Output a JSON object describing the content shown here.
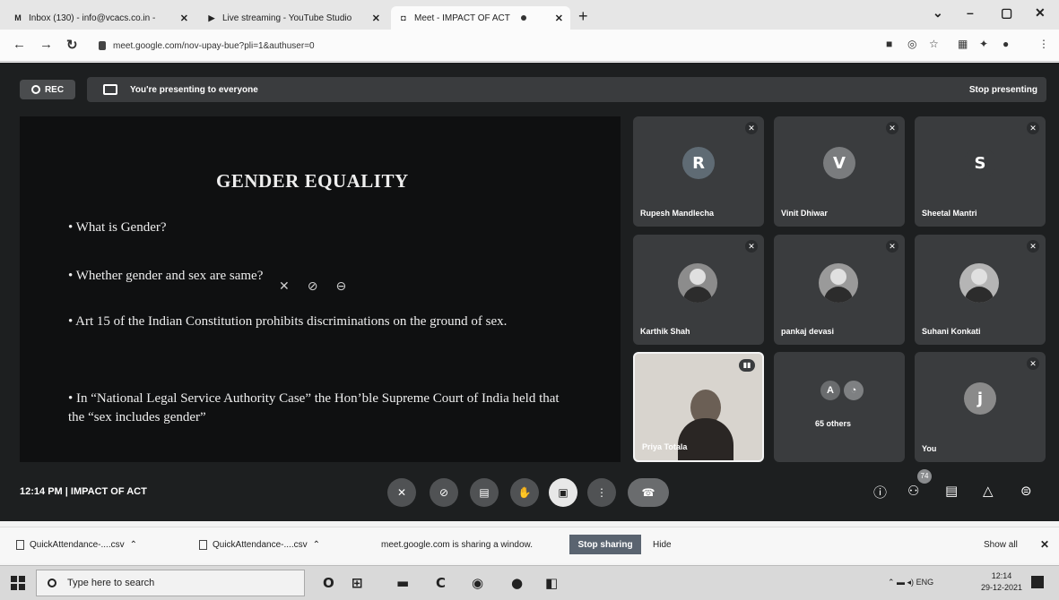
{
  "browser": {
    "tabs": [
      {
        "label": "Inbox (130) - info@vcacs.co.in -",
        "icon": "M"
      },
      {
        "label": "Live streaming - YouTube Studio",
        "icon": "▶"
      },
      {
        "label": "Meet - IMPACT OF ACT",
        "icon": "◘"
      }
    ],
    "url": "meet.google.com/nov-upay-bue?pli=1&authuser=0",
    "window_controls": {
      "minimize": "–",
      "maximize": "▢",
      "close": "✕"
    }
  },
  "meet": {
    "rec_label": "REC",
    "presenting_text": "You're presenting to everyone",
    "stop_presenting_label": "Stop presenting",
    "slide": {
      "title": "GENDER EQUALITY",
      "bullets": [
        "• What is Gender?",
        "• Whether gender and sex are same?",
        "• Art 15 of the Indian Constitution prohibits discriminations on the ground of sex.",
        "• In “National Legal Service Authority Case” the Hon’ble Supreme Court of India held that the “sex includes gender”"
      ]
    },
    "participants": [
      {
        "name": "Rupesh Mandlecha",
        "initial": "R",
        "color": "#5f6b74"
      },
      {
        "name": "Vinit Dhiwar",
        "initial": "V",
        "color": "#7a7c7e"
      },
      {
        "name": "Sheetal Mantri",
        "initial": "S",
        "color": "#3a3c3e"
      },
      {
        "name": "Karthik Shah"
      },
      {
        "name": "pankaj devasi"
      },
      {
        "name": "Suhani Konkati"
      },
      {
        "name": "Priya Totala"
      },
      {
        "name": "65 others",
        "initial": "A"
      },
      {
        "name": "You",
        "initial": "j",
        "color": "#8a8a8a"
      }
    ],
    "time": "12:14 PM",
    "meeting_name": "IMPACT OF ACT",
    "separator": "|",
    "people_count": "74"
  },
  "sharebar": {
    "downloads": [
      "QuickAttendance-....csv",
      "QuickAttendance-....csv"
    ],
    "sharing_message": "meet.google.com is sharing a window.",
    "stop_sharing_label": "Stop sharing",
    "hide_label": "Hide",
    "show_all_label": "Show all"
  },
  "taskbar": {
    "search_placeholder": "Type here to search",
    "tray_text": "ENG",
    "time": "12:14",
    "date": "29-12-2021"
  }
}
